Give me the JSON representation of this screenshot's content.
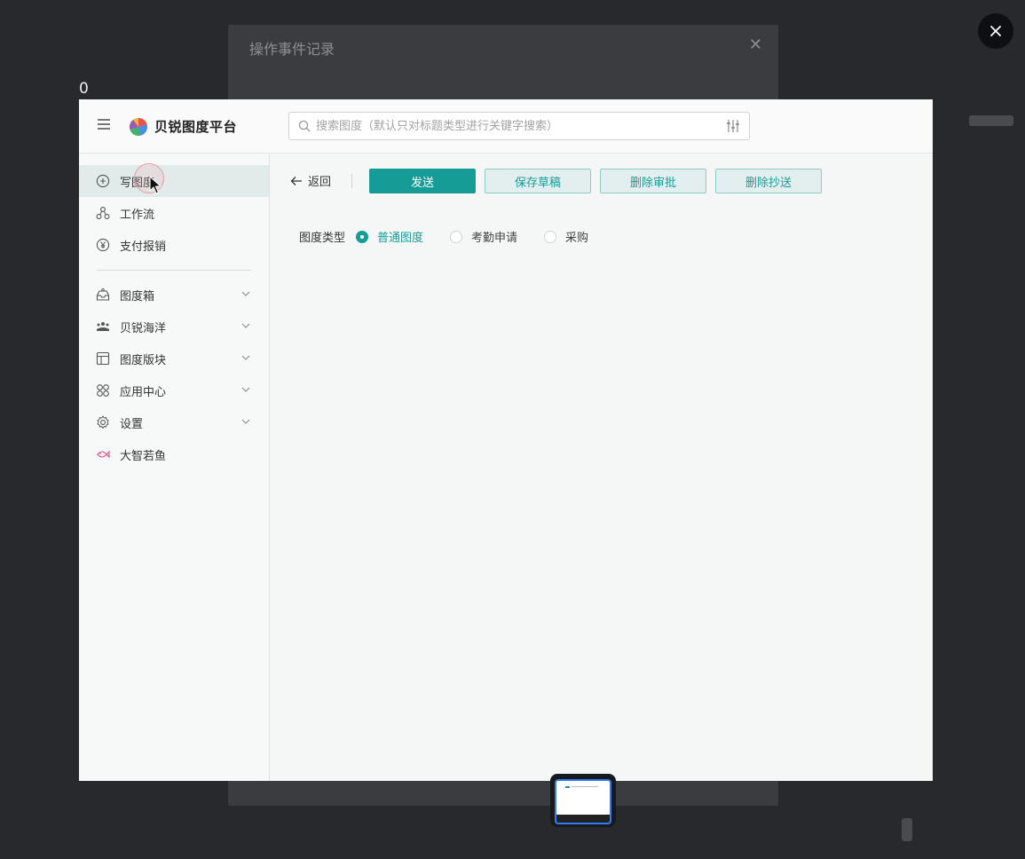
{
  "background": {
    "counter": "0",
    "dialog_title": "操作事件记录"
  },
  "app": {
    "brand": "贝锐图度平台"
  },
  "search": {
    "placeholder": "搜索图度（默认只对标题类型进行关键字搜索）"
  },
  "sidebar": {
    "items": [
      {
        "label": "写图度",
        "icon": "plus-circle-icon",
        "active": true
      },
      {
        "label": "工作流",
        "icon": "workflow-icon"
      },
      {
        "label": "支付报销",
        "icon": "yuan-icon"
      },
      {
        "label": "图度箱",
        "icon": "inbox-icon",
        "expandable": true
      },
      {
        "label": "贝锐海洋",
        "icon": "team-icon",
        "expandable": true
      },
      {
        "label": "图度版块",
        "icon": "layout-icon",
        "expandable": true
      },
      {
        "label": "应用中心",
        "icon": "apps-icon",
        "expandable": true
      },
      {
        "label": "设置",
        "icon": "gear-icon",
        "expandable": true
      },
      {
        "label": "大智若鱼",
        "icon": "fish-icon"
      }
    ]
  },
  "toolbar": {
    "back_label": "返回",
    "send_label": "发送",
    "save_draft_label": "保存草稿",
    "delete_approval_label": "删除审批",
    "delete_cc_label": "删除抄送"
  },
  "form": {
    "type_label": "图度类型",
    "types": [
      {
        "label": "普通图度",
        "checked": true
      },
      {
        "label": "考勤申请",
        "checked": false
      },
      {
        "label": "采购",
        "checked": false
      }
    ]
  },
  "colors": {
    "accent": "#169c97",
    "overlay": "#28292d",
    "thumb_border": "#2f7cf6"
  }
}
